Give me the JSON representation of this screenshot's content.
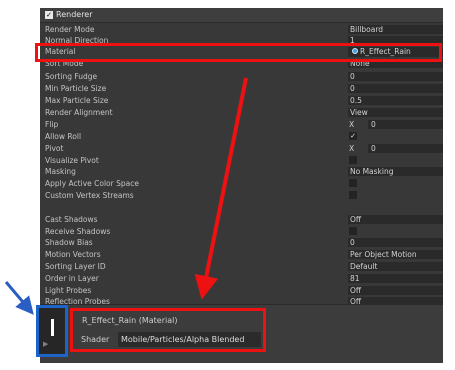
{
  "renderer": {
    "title": "Renderer",
    "enabled_check": "✓",
    "rows": [
      {
        "label": "Render Mode",
        "value": "Billboard",
        "kind": "field"
      },
      {
        "label": "Normal Direction",
        "value": "1",
        "kind": "field"
      },
      {
        "label": "Material",
        "value": "R_Effect_Rain",
        "kind": "material"
      },
      {
        "label": "Sort Mode",
        "value": "None",
        "kind": "field"
      },
      {
        "label": "Sorting Fudge",
        "value": "0",
        "kind": "field"
      },
      {
        "label": "Min Particle Size",
        "value": "0",
        "kind": "field"
      },
      {
        "label": "Max Particle Size",
        "value": "0.5",
        "kind": "field"
      },
      {
        "label": "Render Alignment",
        "value": "View",
        "kind": "field"
      },
      {
        "label": "Flip",
        "x": "X",
        "value": "0",
        "kind": "xfield"
      },
      {
        "label": "Allow Roll",
        "value": "✓",
        "kind": "checkbox"
      },
      {
        "label": "Pivot",
        "x": "X",
        "value": "0",
        "kind": "xfield"
      },
      {
        "label": "Visualize Pivot",
        "value": "",
        "kind": "checkbox"
      },
      {
        "label": "Masking",
        "value": "No Masking",
        "kind": "field"
      },
      {
        "label": "Apply Active Color Space",
        "value": "",
        "kind": "checkbox"
      },
      {
        "label": "Custom Vertex Streams",
        "value": "",
        "kind": "checkbox"
      },
      {
        "label": "",
        "value": "",
        "kind": "spacer"
      },
      {
        "label": "Cast Shadows",
        "value": "Off",
        "kind": "field"
      },
      {
        "label": "Receive Shadows",
        "value": "",
        "kind": "checkbox"
      },
      {
        "label": "Shadow Bias",
        "value": "0",
        "kind": "field"
      },
      {
        "label": "Motion Vectors",
        "value": "Per Object Motion",
        "kind": "field"
      },
      {
        "label": "Sorting Layer ID",
        "value": "Default",
        "kind": "field"
      },
      {
        "label": "Order in Layer",
        "value": "81",
        "kind": "field"
      },
      {
        "label": "Light Probes",
        "value": "Off",
        "kind": "field"
      },
      {
        "label": "Reflection Probes",
        "value": "Off",
        "kind": "field"
      }
    ]
  },
  "material_panel": {
    "title": "R_Effect_Rain (Material)",
    "shader_label": "Shader",
    "shader_value": "Mobile/Particles/Alpha Blended"
  },
  "colors": {
    "highlight": "#ee1111",
    "icon_border": "#1e64c8",
    "panel_bg": "#383838"
  }
}
